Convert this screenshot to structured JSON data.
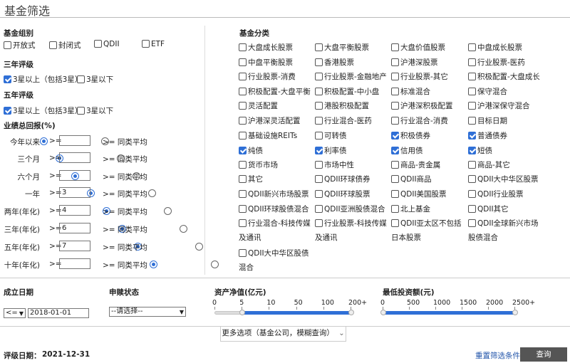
{
  "page": {
    "title": "基金筛选"
  },
  "fund_group": {
    "heading": "基金组别",
    "options": [
      {
        "label": "开放式",
        "checked": false
      },
      {
        "label": "封闭式",
        "checked": false
      },
      {
        "label": "QDII",
        "checked": false
      },
      {
        "label": "ETF",
        "checked": false
      }
    ]
  },
  "rating3": {
    "heading": "三年评级",
    "options": [
      {
        "label": "3星以上（包括3星）",
        "checked": true
      },
      {
        "label": "3星以下",
        "checked": false
      }
    ]
  },
  "rating5": {
    "heading": "五年评级",
    "options": [
      {
        "label": "3星以上（包括3星）",
        "checked": true
      },
      {
        "label": "3星以下",
        "checked": false
      }
    ]
  },
  "performance": {
    "heading": "业绩总回报(%)",
    "gte_label": ">=",
    "peer_label": ">= 同类平均",
    "rows": [
      {
        "label": "今年以来",
        "value": ""
      },
      {
        "label": "三个月",
        "value": ""
      },
      {
        "label": "六个月",
        "value": ""
      },
      {
        "label": "一年",
        "value": "3"
      },
      {
        "label": "两年(年化)",
        "value": "4"
      },
      {
        "label": "三年(年化)",
        "value": "6"
      },
      {
        "label": "五年(年化)",
        "value": "7"
      },
      {
        "label": "十年(年化)",
        "value": ""
      }
    ]
  },
  "category": {
    "heading": "基金分类",
    "items": [
      {
        "label": "大盘成长股票",
        "checked": false
      },
      {
        "label": "大盘平衡股票",
        "checked": false
      },
      {
        "label": "大盘价值股票",
        "checked": false
      },
      {
        "label": "中盘成长股票",
        "checked": false
      },
      {
        "label": "中盘平衡股票",
        "checked": false
      },
      {
        "label": "香港股票",
        "checked": false
      },
      {
        "label": "沪港深股票",
        "checked": false
      },
      {
        "label": "行业股票-医药",
        "checked": false
      },
      {
        "label": "行业股票-消费",
        "checked": false
      },
      {
        "label": "行业股票-金融地产",
        "checked": false
      },
      {
        "label": "行业股票-其它",
        "checked": false
      },
      {
        "label": "积极配置-大盘成长",
        "checked": false
      },
      {
        "label": "积极配置-大盘平衡",
        "checked": false
      },
      {
        "label": "积极配置-中小盘",
        "checked": false
      },
      {
        "label": "标准混合",
        "checked": false
      },
      {
        "label": "保守混合",
        "checked": false
      },
      {
        "label": "灵活配置",
        "checked": false
      },
      {
        "label": "港股积极配置",
        "checked": false
      },
      {
        "label": "沪港深积极配置",
        "checked": false
      },
      {
        "label": "沪港深保守混合",
        "checked": false
      },
      {
        "label": "沪港深灵活配置",
        "checked": false
      },
      {
        "label": "行业混合-医药",
        "checked": false
      },
      {
        "label": "行业混合-消费",
        "checked": false
      },
      {
        "label": "目标日期",
        "checked": false
      },
      {
        "label": "基础设施REITs",
        "checked": false
      },
      {
        "label": "可转债",
        "checked": false
      },
      {
        "label": "积极债券",
        "checked": true
      },
      {
        "label": "普通债券",
        "checked": true
      },
      {
        "label": "纯债",
        "checked": true
      },
      {
        "label": "利率债",
        "checked": true
      },
      {
        "label": "信用债",
        "checked": true
      },
      {
        "label": "短债",
        "checked": true
      },
      {
        "label": "货币市场",
        "checked": false
      },
      {
        "label": "市场中性",
        "checked": false
      },
      {
        "label": "商品-贵金属",
        "checked": false
      },
      {
        "label": "商品-其它",
        "checked": false
      },
      {
        "label": "其它",
        "checked": false
      },
      {
        "label": "QDII环球债券",
        "checked": false
      },
      {
        "label": "QDII商品",
        "checked": false
      },
      {
        "label": "QDII大中华区股票",
        "checked": false
      },
      {
        "label": "QDII新兴市场股票",
        "checked": false
      },
      {
        "label": "QDII环球股票",
        "checked": false
      },
      {
        "label": "QDII美国股票",
        "checked": false
      },
      {
        "label": "QDII行业股票",
        "checked": false
      },
      {
        "label": "QDII环球股债混合",
        "checked": false
      },
      {
        "label": "QDII亚洲股债混合",
        "checked": false
      },
      {
        "label": "北上基金",
        "checked": false
      },
      {
        "label": "QDII其它",
        "checked": false
      },
      {
        "label": "行业混合-科技传媒",
        "line2": "及通讯",
        "checked": false
      },
      {
        "label": "行业股票-科技传媒",
        "line2": "及通讯",
        "checked": false
      },
      {
        "label": "QDII亚太区不包括",
        "line2": "日本股票",
        "checked": false
      },
      {
        "label": "QDII全球新兴市场",
        "line2": "股债混合",
        "checked": false
      },
      {
        "label": "QDII大中华区股债",
        "line2": "混合",
        "checked": false
      }
    ]
  },
  "bottom": {
    "inception_heading": "成立日期",
    "inception_operator": "<=",
    "inception_date": "2018-01-01",
    "status_heading": "申赎状态",
    "status_value": "--请选择--",
    "nav_heading": "资产净值(亿元)",
    "nav_ticks": [
      "0",
      "5",
      "10",
      "50",
      "100",
      "200+"
    ],
    "nav_range": [
      5,
      "200+"
    ],
    "mininv_heading": "最低投资额(元)",
    "mininv_ticks": [
      "0",
      "500",
      "1000",
      "1500",
      "2000",
      "2500+"
    ],
    "mininv_range": [
      0,
      "2500+"
    ]
  },
  "more_options": "更多选项（基金公司，模糊查询）",
  "rating_date_label": "评级日期：",
  "rating_date": "2021-12-31",
  "reset_label": "重置筛选条件",
  "search_label": "查询"
}
